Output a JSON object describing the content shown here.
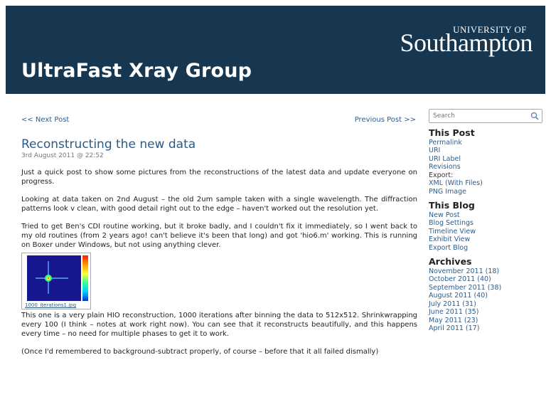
{
  "header": {
    "site_title": "UltraFast Xray Group",
    "logo_top": "UNIVERSITY OF",
    "logo_main": "Southampton",
    "bg_color": "#17364f"
  },
  "nav": {
    "next": "<< Next Post",
    "previous": "Previous Post >>"
  },
  "post": {
    "title": "Reconstructing the new data",
    "date": "3rd August 2011 @ 22:52",
    "paragraphs": [
      "Just a quick post to show some pictures from the reconstructions of the latest data and update everyone on progress.",
      "Looking at data taken on 2nd August – the old 2um sample taken with a single wavelength. The diffraction patterns look v clean, with good detail right out to the edge – haven't worked out the resolution yet.",
      "Tried to get Ben's CDI routine working, but it broke badly, and I couldn't fix it immediately, so I went back to my old routines (from 2 years ago! can't believe it's been that long) and got 'hio6.m' working. This is running on Boxer under Windows, but not using anything clever."
    ],
    "figure_caption": "1000_iterations1.jpg",
    "paragraphs_after": [
      "This one is a very plain HIO reconstruction, 1000 iterations after binning the data to 512x512. Shrinkwrapping every 100 (I think – notes at work right now). You can see that it reconstructs beautifully, and this happens every time – no need for multiple phases to get it to work.",
      "(Once I'd remembered to background-subtract properly, of course – before that it all failed dismally)"
    ]
  },
  "sidebar": {
    "search_placeholder": "Search",
    "this_post": {
      "heading": "This Post",
      "links": [
        "Permalink",
        "URI",
        "URI Label",
        "Revisions"
      ],
      "export_label": "Export:",
      "export_links": [
        "XML (With Files)",
        "PNG Image"
      ]
    },
    "this_blog": {
      "heading": "This Blog",
      "links": [
        "New Post",
        "Blog Settings",
        "Timeline View",
        "Exhibit View",
        "Export Blog"
      ]
    },
    "archives": {
      "heading": "Archives",
      "links": [
        "November 2011 (18)",
        "October 2011 (40)",
        "September 2011 (38)",
        "August 2011 (40)",
        "July 2011 (31)",
        "June 2011 (35)",
        "May 2011 (23)",
        "April 2011 (17)"
      ]
    }
  }
}
